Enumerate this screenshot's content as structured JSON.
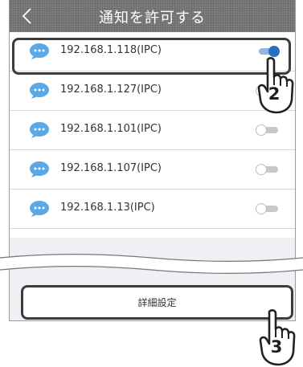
{
  "header": {
    "title": "通知を許可する",
    "back_icon": "chevron-left-icon"
  },
  "devices": [
    {
      "ip": "192.168.1.118(IPC)",
      "enabled": true
    },
    {
      "ip": "192.168.1.127(IPC)",
      "enabled": false
    },
    {
      "ip": "192.168.1.101(IPC)",
      "enabled": false
    },
    {
      "ip": "192.168.1.107(IPC)",
      "enabled": false
    },
    {
      "ip": "192.168.1.13(IPC)",
      "enabled": false
    }
  ],
  "footer": {
    "detail_button_label": "詳細設定"
  },
  "annotations": {
    "step_toggle": "2",
    "step_detail": "3"
  },
  "colors": {
    "header_bg": "#7d7d7d",
    "bubble": "#5aa8e6",
    "toggle_on": "#2b6fc2",
    "highlight_border": "#3c3c3c"
  }
}
